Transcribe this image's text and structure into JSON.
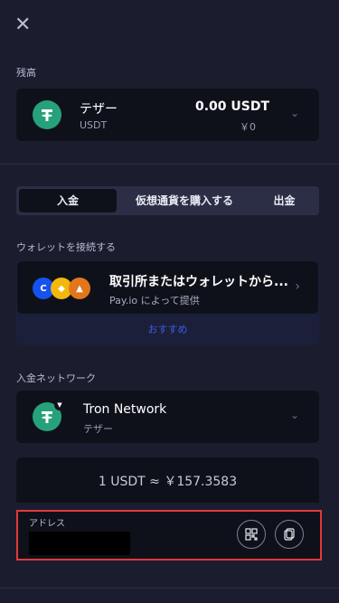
{
  "header": {
    "close_glyph": "✕"
  },
  "balance": {
    "section_label": "残高",
    "asset_name": "テザー",
    "asset_code": "USDT",
    "amount": "0.00 USDT",
    "fiat": "￥0",
    "icon": "tether-icon"
  },
  "tabs": [
    {
      "label": "入金",
      "active": true
    },
    {
      "label": "仮想通貨を購入する",
      "active": false
    },
    {
      "label": "出金",
      "active": false
    }
  ],
  "wallet": {
    "section_label": "ウォレットを接続する",
    "title": "取引所またはウォレットから...",
    "provider": "Pay.io によって提供",
    "recommended": "おすすめ",
    "icons": [
      "coinbase-icon",
      "binance-icon",
      "metamask-icon"
    ]
  },
  "network": {
    "section_label": "入金ネットワーク",
    "name": "Tron Network",
    "sub": "テザー",
    "icon": "tether-tron-icon"
  },
  "rate": {
    "text": "1 USDT ≈ ￥157.3583"
  },
  "address": {
    "label": "アドレス",
    "qr_icon": "qr-code-icon",
    "copy_icon": "copy-icon"
  },
  "colors": {
    "background": "#1b1d2f",
    "card": "#0f111a",
    "tether_green": "#26a17b",
    "highlight_red": "#e03a3a",
    "accent_blue": "#3d5be0"
  }
}
